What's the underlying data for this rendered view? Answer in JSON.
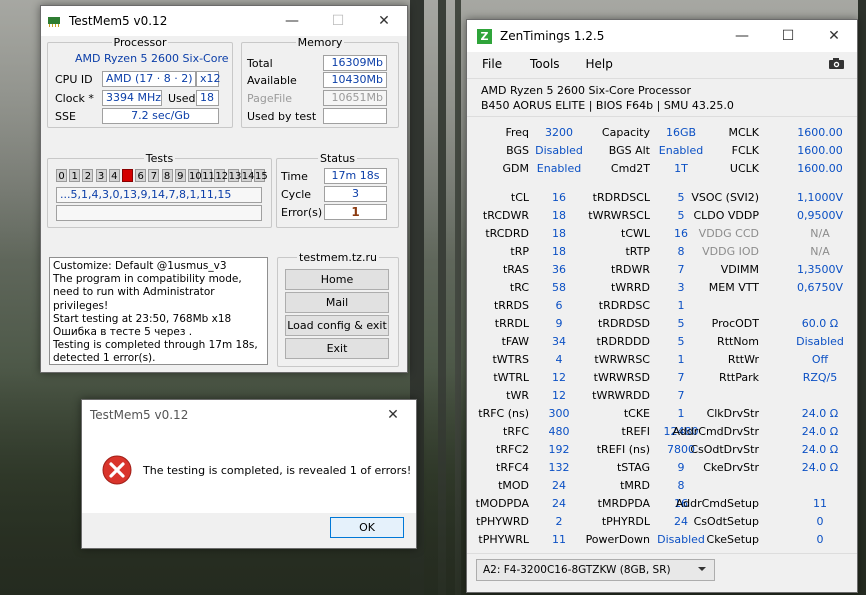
{
  "testmem": {
    "title": "TestMem5 v0.12",
    "processor": {
      "legend": "Processor",
      "name": "AMD Ryzen 5 2600 Six-Core",
      "cpu_id_label": "CPU ID",
      "cpu_id": "AMD (17 · 8 · 2)",
      "threads": "x12",
      "clock_label": "Clock *",
      "clock": "3394 MHz",
      "used_label": "Used",
      "used": "18",
      "sse_label": "SSE",
      "sse": "7.2 sec/Gb"
    },
    "memory": {
      "legend": "Memory",
      "total_label": "Total",
      "total": "16309Mb",
      "available_label": "Available",
      "available": "10430Mb",
      "pagefile_label": "PageFile",
      "pagefile": "10651Mb",
      "usedbytest_label": "Used by test",
      "usedbytest": ""
    },
    "tests": {
      "legend": "Tests",
      "cells": [
        "0",
        "1",
        "2",
        "3",
        "4",
        "5",
        "6",
        "7",
        "8",
        "9",
        "10",
        "11",
        "12",
        "13",
        "14",
        "15"
      ],
      "error_cell": "5",
      "sequence": "...5,1,4,3,0,13,9,14,7,8,1,11,15"
    },
    "status": {
      "legend": "Status",
      "time_label": "Time",
      "time": "17m 18s",
      "cycle_label": "Cycle",
      "cycle": "3",
      "errors_label": "Error(s)",
      "errors": "1"
    },
    "log": [
      "Customize: Default @1usmus_v3",
      "The program in compatibility mode,",
      "need to run with Administrator privileges!",
      "Start testing at 23:50, 768Mb x18",
      "Ошибка в тесте 5 через .",
      "Testing is completed through 17m 18s,",
      "detected 1 error(s)."
    ],
    "site": {
      "legend": "testmem.tz.ru",
      "home": "Home",
      "mail": "Mail",
      "load": "Load config & exit",
      "exit": "Exit"
    }
  },
  "dialog": {
    "title": "TestMem5 v0.12",
    "message": "The testing is completed, is revealed 1 of errors!",
    "ok": "OK"
  },
  "zen": {
    "title": "ZenTimings 1.2.5",
    "menu": [
      "File",
      "Tools",
      "Help"
    ],
    "cpu": "AMD Ryzen 5 2600 Six-Core Processor",
    "board": "B450 AORUS ELITE | BIOS F64b | SMU 43.25.0",
    "top": [
      {
        "l1": "Freq",
        "v1": "3200",
        "l2": "Capacity",
        "v2": "16GB",
        "l3": "MCLK",
        "v3": "1600.00"
      },
      {
        "l1": "BGS",
        "v1": "Disabled",
        "l2": "BGS Alt",
        "v2": "Enabled",
        "l3": "FCLK",
        "v3": "1600.00"
      },
      {
        "l1": "GDM",
        "v1": "Enabled",
        "l2": "Cmd2T",
        "v2": "1T",
        "l3": "UCLK",
        "v3": "1600.00"
      }
    ],
    "rows": [
      {
        "l1": "tCL",
        "v1": "16",
        "l2": "tRDRDSCL",
        "v2": "5",
        "l3": "VSOC (SVI2)",
        "v3": "1,1000V"
      },
      {
        "l1": "tRCDWR",
        "v1": "18",
        "l2": "tWRWRSCL",
        "v2": "5",
        "l3": "CLDO VDDP",
        "v3": "0,9500V"
      },
      {
        "l1": "tRCDRD",
        "v1": "18",
        "l2": "tCWL",
        "v2": "16",
        "l3": "VDDG CCD",
        "v3": "N/A",
        "dim": true
      },
      {
        "l1": "tRP",
        "v1": "18",
        "l2": "tRTP",
        "v2": "8",
        "l3": "VDDG IOD",
        "v3": "N/A",
        "dim": true
      },
      {
        "l1": "tRAS",
        "v1": "36",
        "l2": "tRDWR",
        "v2": "7",
        "l3": "VDIMM",
        "v3": "1,3500V"
      },
      {
        "l1": "tRC",
        "v1": "58",
        "l2": "tWRRD",
        "v2": "3",
        "l3": "MEM VTT",
        "v3": "0,6750V"
      },
      {
        "l1": "tRRDS",
        "v1": "6",
        "l2": "tRDRDSC",
        "v2": "1",
        "l3": "",
        "v3": ""
      },
      {
        "l1": "tRRDL",
        "v1": "9",
        "l2": "tRDRDSD",
        "v2": "5",
        "l3": "ProcODT",
        "v3": "60.0 Ω"
      },
      {
        "l1": "tFAW",
        "v1": "34",
        "l2": "tRDRDDD",
        "v2": "5",
        "l3": "RttNom",
        "v3": "Disabled"
      },
      {
        "l1": "tWTRS",
        "v1": "4",
        "l2": "tWRWRSC",
        "v2": "1",
        "l3": "RttWr",
        "v3": "Off"
      },
      {
        "l1": "tWTRL",
        "v1": "12",
        "l2": "tWRWRSD",
        "v2": "7",
        "l3": "RttPark",
        "v3": "RZQ/5"
      },
      {
        "l1": "tWR",
        "v1": "12",
        "l2": "tWRWRDD",
        "v2": "7",
        "l3": "",
        "v3": ""
      },
      {
        "l1": "tRFC (ns)",
        "v1": "300",
        "l2": "tCKE",
        "v2": "1",
        "l3": "ClkDrvStr",
        "v3": "24.0 Ω"
      },
      {
        "l1": "tRFC",
        "v1": "480",
        "l2": "tREFI",
        "v2": "12480",
        "l3": "AddrCmdDrvStr",
        "v3": "24.0 Ω"
      },
      {
        "l1": "tRFC2",
        "v1": "192",
        "l2": "tREFI (ns)",
        "v2": "7800",
        "l3": "CsOdtDrvStr",
        "v3": "24.0 Ω"
      },
      {
        "l1": "tRFC4",
        "v1": "132",
        "l2": "tSTAG",
        "v2": "9",
        "l3": "CkeDrvStr",
        "v3": "24.0 Ω"
      },
      {
        "l1": "tMOD",
        "v1": "24",
        "l2": "tMRD",
        "v2": "8",
        "l3": "",
        "v3": ""
      },
      {
        "l1": "tMODPDA",
        "v1": "24",
        "l2": "tMRDPDA",
        "v2": "16",
        "l3": "AddrCmdSetup",
        "v3": "11"
      },
      {
        "l1": "tPHYWRD",
        "v1": "2",
        "l2": "tPHYRDL",
        "v2": "24",
        "l3": "CsOdtSetup",
        "v3": "0"
      },
      {
        "l1": "tPHYWRL",
        "v1": "11",
        "l2": "PowerDown",
        "v2": "Disabled",
        "l3": "CkeSetup",
        "v3": "0"
      }
    ],
    "module": "A2: F4-3200C16-8GTZKW (8GB, SR)",
    "colors": {
      "value": "#0b50c4",
      "dim": "#8c8c8c",
      "error_cell": "#d40000",
      "error_count": "#8b3a10",
      "logo": "#2fa43a"
    }
  }
}
